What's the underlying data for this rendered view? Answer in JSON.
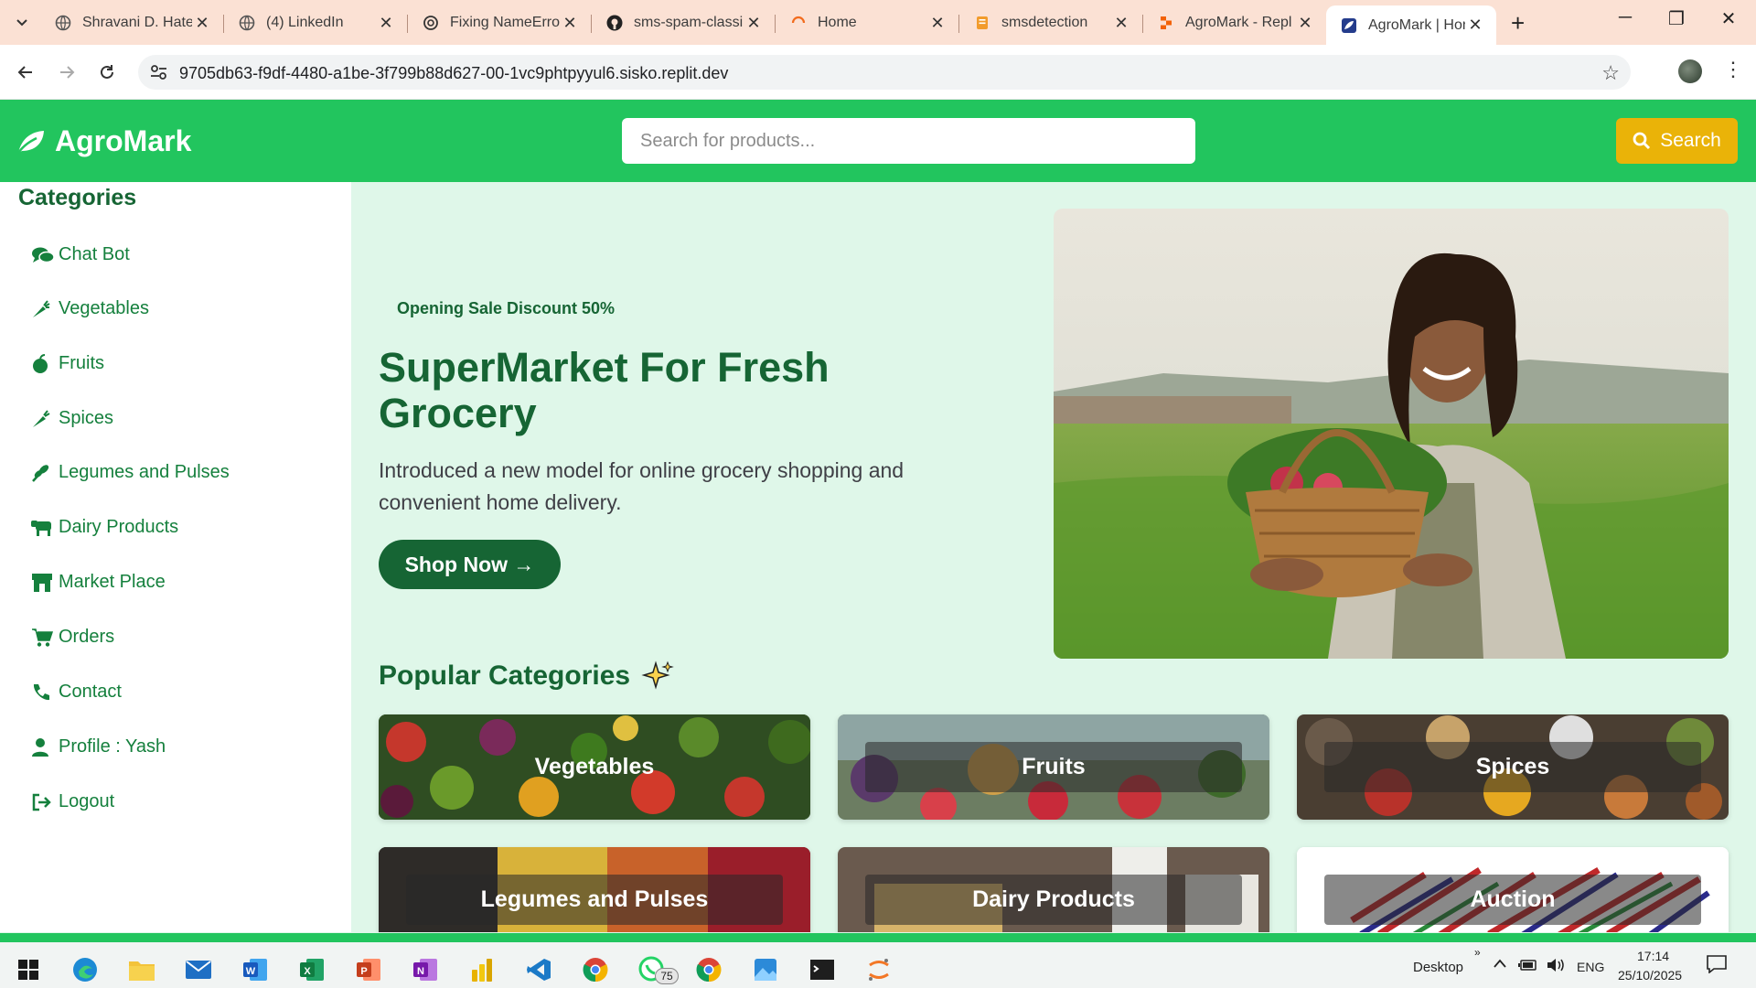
{
  "browser": {
    "tabs": [
      {
        "title": "Shravani D. Hate",
        "icon": "globe-icon"
      },
      {
        "title": "(4) LinkedIn",
        "icon": "globe-icon"
      },
      {
        "title": "Fixing NameErro",
        "icon": "openai-icon"
      },
      {
        "title": "sms-spam-classi",
        "icon": "github-icon"
      },
      {
        "title": "Home",
        "icon": "loading-icon"
      },
      {
        "title": "smsdetection",
        "icon": "notebook-icon"
      },
      {
        "title": "AgroMark - Repl",
        "icon": "replit-icon"
      },
      {
        "title": "AgroMark | Hom",
        "icon": "site-icon"
      }
    ],
    "url": "9705db63-f9df-4480-a1be-3f799b88d627-00-1vc9phtpyyul6.sisko.replit.dev"
  },
  "site": {
    "brand": "AgroMark",
    "search_placeholder": "Search for products...",
    "search_label": "Search",
    "colors": {
      "primary": "#22c55e",
      "dark": "#166534",
      "accent": "#eab308",
      "bg": "#dff7e9"
    }
  },
  "sidebar": {
    "title": "Categories",
    "items": [
      {
        "label": "Chat Bot",
        "icon": "comments-icon"
      },
      {
        "label": "Vegetables",
        "icon": "carrot-icon"
      },
      {
        "label": "Fruits",
        "icon": "apple-icon"
      },
      {
        "label": "Spices",
        "icon": "pepper-icon"
      },
      {
        "label": "Legumes and Pulses",
        "icon": "seedling-icon"
      },
      {
        "label": "Dairy Products",
        "icon": "cow-icon"
      },
      {
        "label": "Market Place",
        "icon": "store-icon"
      },
      {
        "label": "Orders",
        "icon": "cart-icon"
      },
      {
        "label": "Contact",
        "icon": "phone-icon"
      },
      {
        "label": "Profile : Yash",
        "icon": "user-icon"
      },
      {
        "label": "Logout",
        "icon": "logout-icon"
      }
    ]
  },
  "hero": {
    "promo": "Opening Sale Discount 50%",
    "title": "SuperMarket For Fresh Grocery",
    "description": "Introduced a new model for online grocery shopping and convenient home delivery.",
    "cta": "Shop Now →"
  },
  "popular": {
    "title": "Popular Categories",
    "cards": [
      {
        "label": "Vegetables"
      },
      {
        "label": "Fruits"
      },
      {
        "label": "Spices"
      },
      {
        "label": "Legumes and Pulses"
      },
      {
        "label": "Dairy Products"
      },
      {
        "label": "Auction"
      }
    ]
  },
  "taskbar": {
    "desktop_label": "Desktop",
    "lang": "ENG",
    "time": "17:14",
    "date": "25/10/2025",
    "whatsapp_badge": "75"
  }
}
